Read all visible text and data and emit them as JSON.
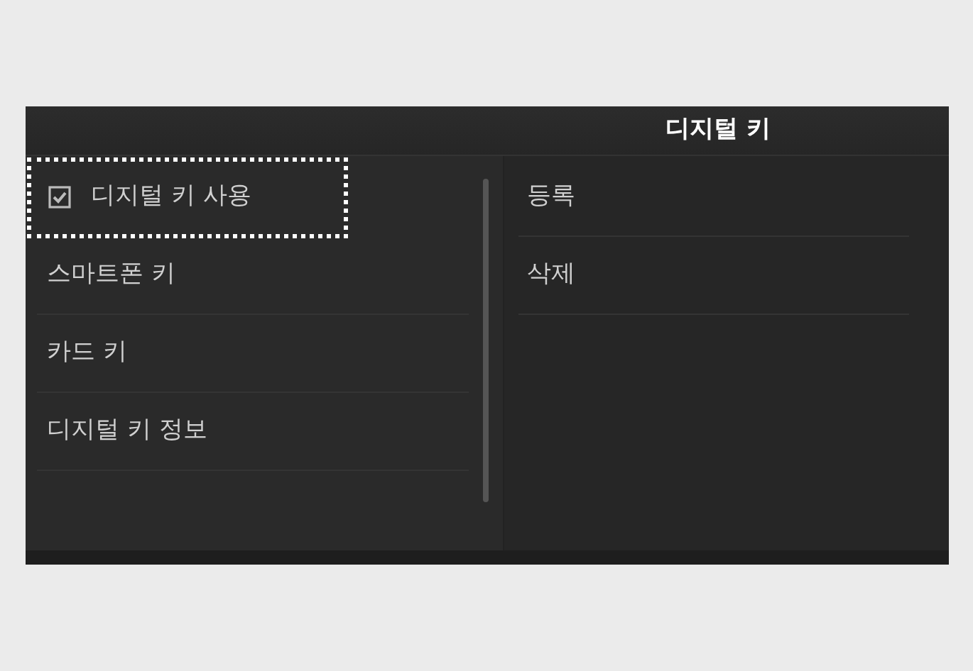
{
  "header": {
    "title": "디지털 키"
  },
  "menu": [
    {
      "kind": "checkbox",
      "label": "디지털 키 사용",
      "checked": true,
      "focused": true
    },
    {
      "kind": "item",
      "label": "스마트폰 키",
      "focused": false
    },
    {
      "kind": "item",
      "label": "카드 키",
      "focused": false
    },
    {
      "kind": "item",
      "label": "디지털 키 정보",
      "focused": false
    }
  ],
  "submenu": [
    {
      "label": "등록"
    },
    {
      "label": "삭제"
    }
  ]
}
